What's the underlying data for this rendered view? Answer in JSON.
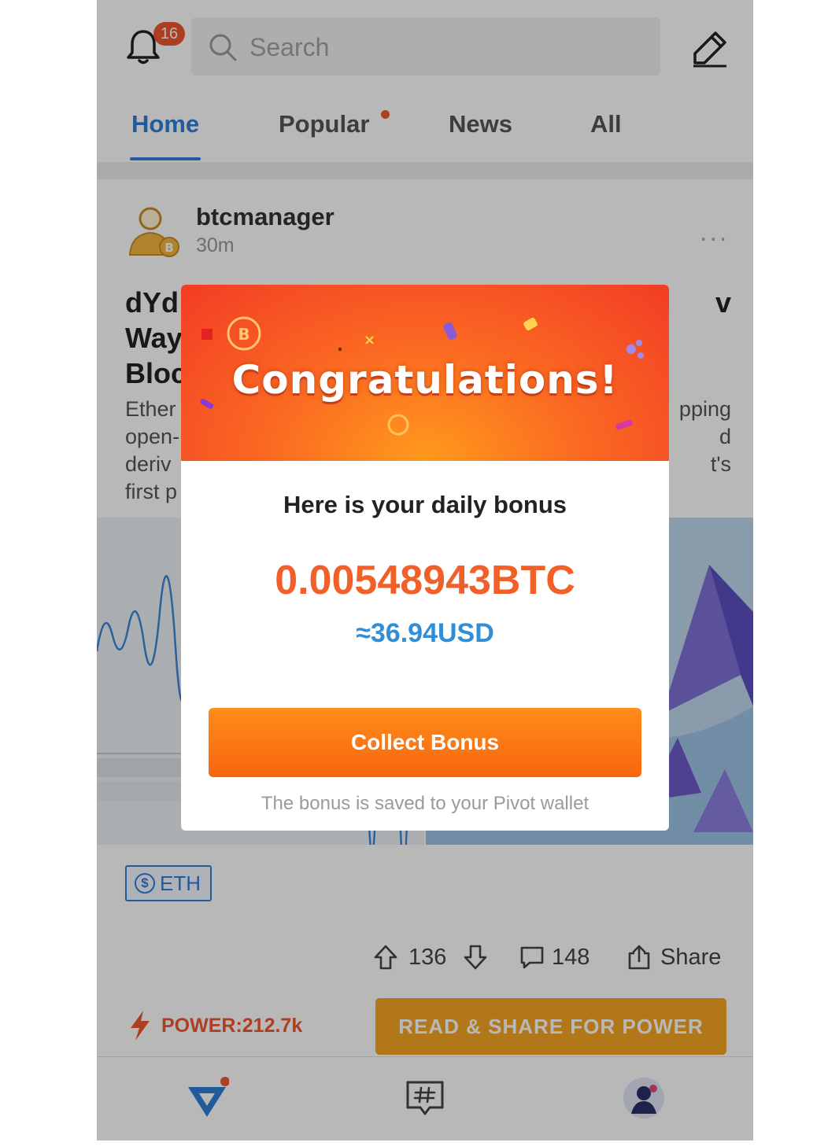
{
  "header": {
    "notification_count": "16",
    "search_placeholder": "Search"
  },
  "tabs": [
    {
      "label": "Home",
      "active": true
    },
    {
      "label": "Popular",
      "has_dot": true
    },
    {
      "label": "News"
    },
    {
      "label": "All"
    }
  ],
  "post": {
    "author": "btcmanager",
    "time": "30m",
    "more": "...",
    "title_visible_left": [
      "dYd",
      "Way",
      "Bloc"
    ],
    "title_visible_right": [
      "v",
      "",
      ""
    ],
    "excerpt_visible_left": [
      "Ether",
      "open-",
      "deriv",
      "first p"
    ],
    "excerpt_visible_right": [
      "pping",
      "d",
      "t's",
      ""
    ],
    "tag": {
      "symbol": "$",
      "label": "ETH"
    },
    "upvotes": "136",
    "comments": "148",
    "share_label": "Share"
  },
  "power": {
    "label": "POWER:212.7k",
    "button_label": "READ & SHARE FOR POWER"
  },
  "modal": {
    "heading": "Congratulations!",
    "subtitle": "Here is your daily bonus",
    "btc_amount": "0.00548943BTC",
    "usd_amount": "≈36.94USD",
    "button_label": "Collect Bonus",
    "note": "The bonus is saved to your Pivot wallet"
  },
  "colors": {
    "accent_blue": "#2f7fd8",
    "accent_orange": "#f0582f",
    "power_button": "#f5a623",
    "bonus_amount": "#f2602a",
    "usd_amount": "#2f8ed8"
  },
  "icons": {
    "bell": "bell-icon",
    "search": "search-icon",
    "compose": "pencil-icon",
    "upvote": "arrow-up-icon",
    "downvote": "arrow-down-icon",
    "comment": "comment-icon",
    "share": "share-icon",
    "power": "lightning-icon",
    "nav_home": "pivot-logo-icon",
    "nav_topics": "hashtag-icon",
    "nav_profile": "avatar-icon"
  }
}
